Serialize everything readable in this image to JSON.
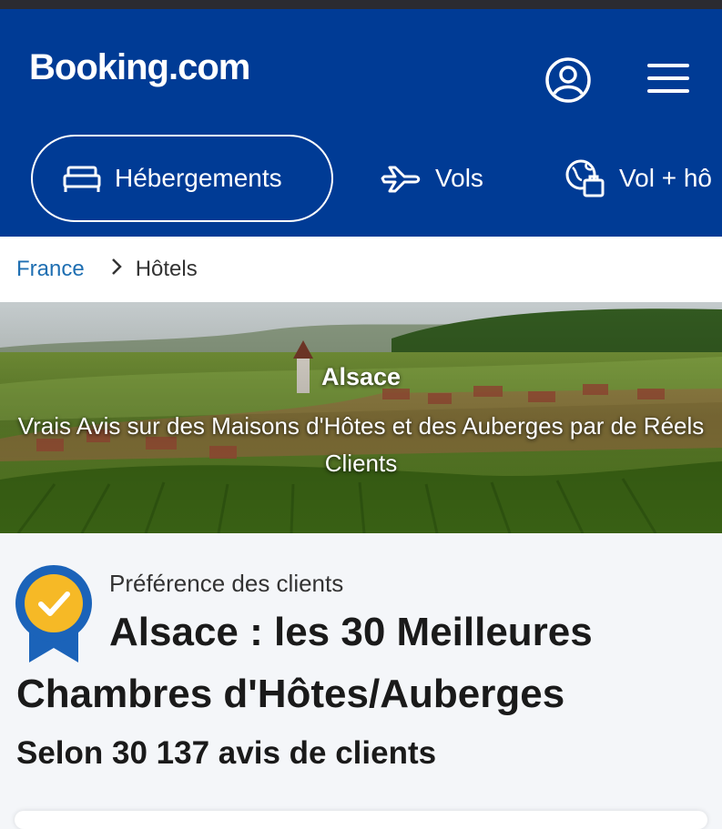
{
  "header": {
    "logo": "Booking.com",
    "bg_color": "#003b95",
    "icons": {
      "account": "user-circle-icon",
      "menu": "hamburger-menu-icon"
    }
  },
  "tabs": [
    {
      "label": "Hébergements",
      "icon": "bed-icon",
      "active": true
    },
    {
      "label": "Vols",
      "icon": "plane-icon",
      "active": false
    },
    {
      "label": "Vol + hô",
      "icon": "globe-suitcase-icon",
      "active": false
    }
  ],
  "breadcrumb": {
    "items": [
      {
        "label": "France",
        "link": true
      },
      {
        "label": "Hôtels",
        "link": false
      }
    ],
    "link_color": "#1f6fb2"
  },
  "hero": {
    "title": "Alsace",
    "subtitle": "Vrais Avis sur des Maisons d'Hôtes et des Auberges par de Réels Clients"
  },
  "content": {
    "eyebrow": "Préférence des clients",
    "title_line1": "Alsace : les 30 Meilleures",
    "title_line2": "Chambres d'Hôtes/Auberges",
    "subtitle": "Selon 30 137 avis de clients",
    "badge_icon": "award-badge-icon",
    "badge_colors": {
      "ribbon": "#1b63b9",
      "medal": "#f6b926"
    }
  }
}
